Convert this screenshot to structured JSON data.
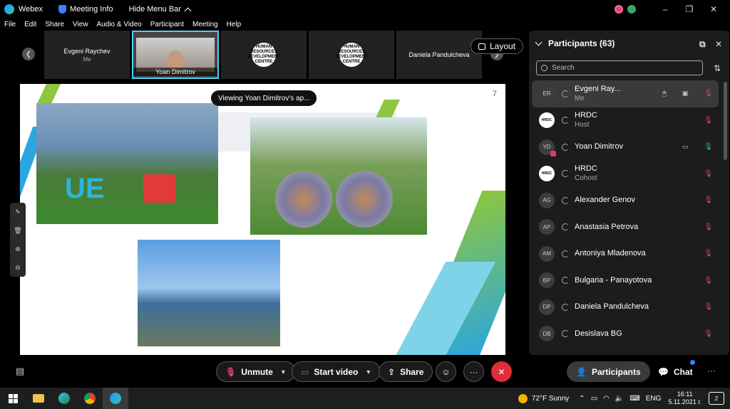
{
  "titlebar": {
    "app_name": "Webex",
    "meeting_info": "Meeting Info",
    "hide_menu": "Hide Menu Bar",
    "minimize": "–",
    "restore": "❐",
    "close": "✕"
  },
  "menu": [
    "File",
    "Edit",
    "Share",
    "View",
    "Audio & Video",
    "Participant",
    "Meeting",
    "Help"
  ],
  "filmstrip": {
    "tiles": [
      {
        "name": "Evgeni Raychev",
        "sub": "Me"
      },
      {
        "name": "Yoan Dimitrov"
      },
      {
        "logo": "HUMAN\nRESOURCES\nDEVELOPMENT\nCENTRE"
      },
      {
        "logo": "HUMAN\nRESOURCES\nDEVELOPMENT\nCENTRE"
      },
      {
        "name": "Daniela Pandulcheva"
      }
    ],
    "layout_label": "Layout"
  },
  "slide": {
    "page_number": "7",
    "viewing_label": "Viewing Yoan Dimitrov's ap..."
  },
  "panel": {
    "title": "Participants (63)",
    "search_placeholder": "Search",
    "participants": [
      {
        "initials": "ER",
        "name": "Evgeni Ray...",
        "role": "Me",
        "mic": "muted"
      },
      {
        "initials": "HRDC",
        "name": "HRDC",
        "role": "Host",
        "mic": "muted",
        "logo": true
      },
      {
        "initials": "YD",
        "name": "Yoan Dimitrov",
        "role": "",
        "mic": "on",
        "video": true
      },
      {
        "initials": "HRDC",
        "name": "HRDC",
        "role": "Cohost",
        "mic": "muted",
        "logo": true
      },
      {
        "initials": "AG",
        "name": "Alexander Genov",
        "role": "",
        "mic": "muted"
      },
      {
        "initials": "AP",
        "name": "Anastasia Petrova",
        "role": "",
        "mic": "muted"
      },
      {
        "initials": "AM",
        "name": "Antoniya Mladenova",
        "role": "",
        "mic": "muted"
      },
      {
        "initials": "BP",
        "name": "Bulgaria - Panayotova",
        "role": "",
        "mic": "muted"
      },
      {
        "initials": "DP",
        "name": "Daniela Pandulcheva",
        "role": "",
        "mic": "muted"
      },
      {
        "initials": "DB",
        "name": "Desislava BG",
        "role": "",
        "mic": "muted"
      }
    ]
  },
  "controls": {
    "unmute": "Unmute",
    "start_video": "Start video",
    "share": "Share",
    "participants": "Participants",
    "chat": "Chat",
    "more": "···"
  },
  "taskbar": {
    "weather": "72°F  Sunny",
    "lang": "ENG",
    "time": "16:11",
    "date": "5.11.2021 г.",
    "notif_count": "2"
  },
  "colors": {
    "accent_blue": "#3b82f6",
    "muted_red": "#e34a6f",
    "end_red": "#e02d3c",
    "active_tile": "#4ad3f5"
  }
}
